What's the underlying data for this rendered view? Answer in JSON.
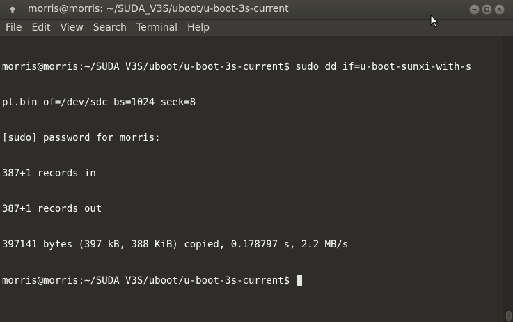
{
  "window": {
    "title": "morris@morris: ~/SUDA_V3S/uboot/u-boot-3s-current",
    "controls": {
      "minimize_icon": "minimize-icon",
      "maximize_icon": "maximize-icon",
      "close_icon": "close-icon"
    }
  },
  "menubar": {
    "items": [
      "File",
      "Edit",
      "View",
      "Search",
      "Terminal",
      "Help"
    ]
  },
  "terminal": {
    "lines": [
      "morris@morris:~/SUDA_V3S/uboot/u-boot-3s-current$ sudo dd if=u-boot-sunxi-with-s",
      "pl.bin of=/dev/sdc bs=1024 seek=8",
      "[sudo] password for morris:",
      "387+1 records in",
      "387+1 records out",
      "397141 bytes (397 kB, 388 KiB) copied, 0.178797 s, 2.2 MB/s",
      "morris@morris:~/SUDA_V3S/uboot/u-boot-3s-current$ "
    ]
  },
  "colors": {
    "terminal_bg": "#2e2d29",
    "text": "#ffffff",
    "titlebar": "#3c3b37"
  }
}
